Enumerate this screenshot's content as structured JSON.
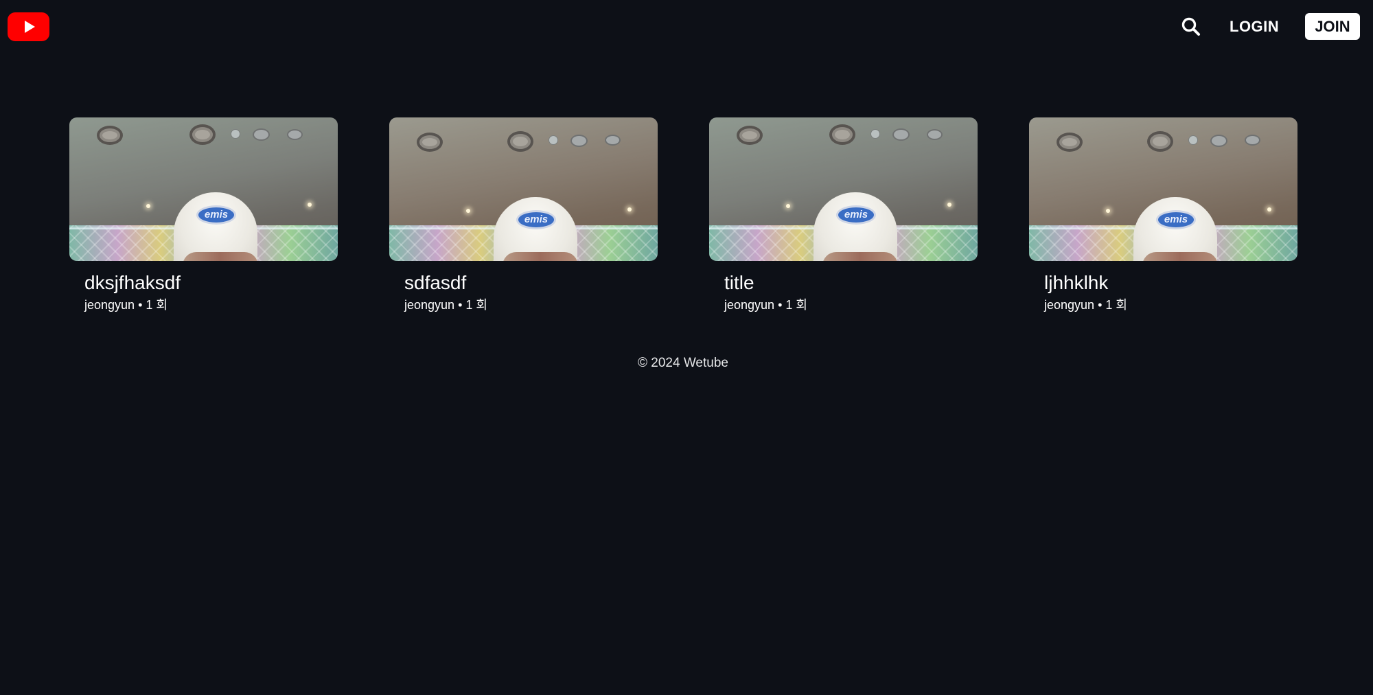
{
  "app": {
    "brand_color": "#ff0000",
    "background_color": "#0d1017",
    "logo_icon": "youtube-play-icon"
  },
  "header": {
    "search_icon": "search-icon",
    "login_label": "LOGIN",
    "join_label": "JOIN"
  },
  "videos": [
    {
      "title": "dksjfhaksdf",
      "owner": "jeongyun",
      "views": "1 회",
      "separator": "•",
      "thumbnail_tone": "cool"
    },
    {
      "title": "sdfasdf",
      "owner": "jeongyun",
      "views": "1 회",
      "separator": "•",
      "thumbnail_tone": "warm"
    },
    {
      "title": "title",
      "owner": "jeongyun",
      "views": "1 회",
      "separator": "•",
      "thumbnail_tone": "cool"
    },
    {
      "title": "ljhhklhk",
      "owner": "jeongyun",
      "views": "1 회",
      "separator": "•",
      "thumbnail_tone": "warm"
    }
  ],
  "thumbnail_text": "emis",
  "footer": {
    "text": "© 2024 Wetube"
  }
}
